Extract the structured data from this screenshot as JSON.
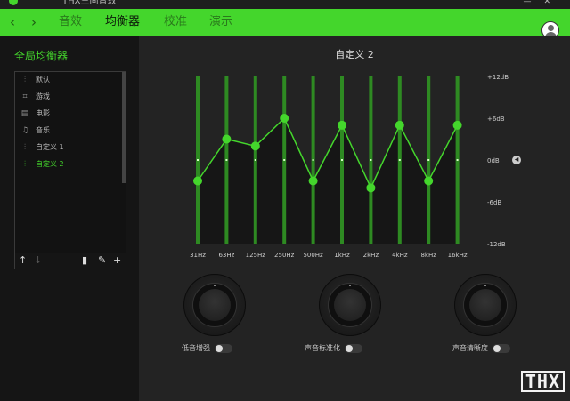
{
  "app": {
    "title": "THX空间音效"
  },
  "colors": {
    "accent": "#44d62c",
    "background": "#1b1b1b"
  },
  "nav": {
    "back_icon": "chevron-left-icon",
    "forward_icon": "chevron-right-icon"
  },
  "tabs": [
    {
      "label": "音效",
      "active": false
    },
    {
      "label": "均衡器",
      "active": true
    },
    {
      "label": "校准",
      "active": false
    },
    {
      "label": "演示",
      "active": false
    }
  ],
  "sidebar": {
    "title": "全局均衡器",
    "presets": [
      {
        "label": "默认",
        "icon": "sliders-icon",
        "selected": false
      },
      {
        "label": "游戏",
        "icon": "gamepad-icon",
        "selected": false
      },
      {
        "label": "电影",
        "icon": "film-icon",
        "selected": false
      },
      {
        "label": "音乐",
        "icon": "music-note-icon",
        "selected": false
      },
      {
        "label": "自定义 1",
        "icon": "sliders-icon",
        "selected": false
      },
      {
        "label": "自定义 2",
        "icon": "sliders-icon",
        "selected": true
      }
    ]
  },
  "eq": {
    "title": "自定义 2",
    "db_labels": [
      "+12dB",
      "+6dB",
      "0dB",
      "-6dB",
      "-12dB"
    ],
    "bands": [
      "31Hz",
      "63Hz",
      "125Hz",
      "250Hz",
      "500Hz",
      "1kHz",
      "2kHz",
      "4kHz",
      "8kHz",
      "16kHz"
    ],
    "gains_db": [
      -3,
      3,
      2,
      6,
      -3,
      5,
      -4,
      5,
      -3,
      5
    ]
  },
  "knobs": [
    {
      "label": "低音增强",
      "value": "55",
      "on": false
    },
    {
      "label": "声音标准化",
      "value": "55",
      "on": false
    },
    {
      "label": "声音清晰度",
      "value": "55",
      "on": false
    }
  ],
  "watermark": "THX"
}
